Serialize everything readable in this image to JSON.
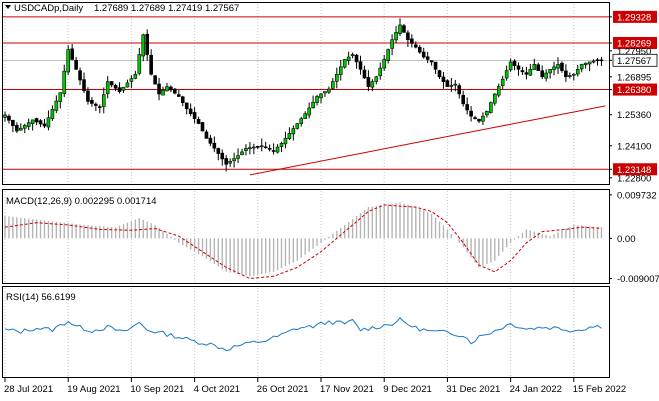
{
  "window": {
    "symbol_timeframe": "USDCADp,Daily",
    "ohlc": "1.27689 1.27689 1.27419 1.27567",
    "icon": "chart-arrow-icon"
  },
  "colors": {
    "background": "#ffffff",
    "grid": "#c8c8c8",
    "border": "#000000",
    "candle_up": "#000000",
    "candle_up_body": "#00c800",
    "candle_down": "#000000",
    "resistance_line": "#cc0000",
    "label_bg": "#cc0000",
    "label_text": "#ffffff",
    "price_label_bg": "#ffffff",
    "macd_hist": "#b4b4b4",
    "macd_signal": "#cc0000",
    "rsi_line": "#1e78c8"
  },
  "chart_data": [
    {
      "type": "candlestick",
      "panel": "price",
      "title": "USDCADp,Daily",
      "ylim": [
        1.2255,
        1.2985
      ],
      "y_ticks": [
        "1.29328",
        "1.28269",
        "1.27950",
        "1.27567",
        "1.26895",
        "1.26380",
        "1.25360",
        "1.24100",
        "1.23148",
        "1.22800"
      ],
      "x_tick_labels": [
        "28 Jul 2021",
        "19 Aug 2021",
        "10 Sep 2021",
        "4 Oct 2021",
        "26 Oct 2021",
        "17 Nov 2021",
        "9 Dec 2021",
        "31 Dec 2021",
        "24 Jan 2022",
        "15 Feb 2022"
      ],
      "x_tick_index": [
        0,
        16,
        32,
        48,
        64,
        80,
        96,
        112,
        128,
        144
      ],
      "close_anchors": [
        [
          0,
          1.2535
        ],
        [
          3,
          1.247
        ],
        [
          7,
          1.2515
        ],
        [
          10,
          1.249
        ],
        [
          14,
          1.2625
        ],
        [
          16,
          1.28
        ],
        [
          18,
          1.272
        ],
        [
          21,
          1.259
        ],
        [
          24,
          1.2565
        ],
        [
          26,
          1.267
        ],
        [
          29,
          1.263
        ],
        [
          33,
          1.27
        ],
        [
          35,
          1.286
        ],
        [
          37,
          1.27
        ],
        [
          39,
          1.262
        ],
        [
          41,
          1.265
        ],
        [
          44,
          1.261
        ],
        [
          46,
          1.256
        ],
        [
          49,
          1.25
        ],
        [
          51,
          1.244
        ],
        [
          53,
          1.24
        ],
        [
          56,
          1.2335
        ],
        [
          59,
          1.237
        ],
        [
          61,
          1.24
        ],
        [
          65,
          1.241
        ],
        [
          68,
          1.239
        ],
        [
          70,
          1.242
        ],
        [
          73,
          1.248
        ],
        [
          76,
          1.254
        ],
        [
          79,
          1.261
        ],
        [
          82,
          1.264
        ],
        [
          84,
          1.27
        ],
        [
          86,
          1.276
        ],
        [
          88,
          1.278
        ],
        [
          90,
          1.272
        ],
        [
          92,
          1.265
        ],
        [
          94,
          1.269
        ],
        [
          96,
          1.276
        ],
        [
          98,
          1.284
        ],
        [
          100,
          1.29
        ],
        [
          102,
          1.284
        ],
        [
          104,
          1.281
        ],
        [
          106,
          1.277
        ],
        [
          108,
          1.275
        ],
        [
          110,
          1.269
        ],
        [
          112,
          1.265
        ],
        [
          114,
          1.266
        ],
        [
          116,
          1.258
        ],
        [
          118,
          1.253
        ],
        [
          120,
          1.251
        ],
        [
          122,
          1.255
        ],
        [
          124,
          1.262
        ],
        [
          126,
          1.268
        ],
        [
          128,
          1.275
        ],
        [
          130,
          1.272
        ],
        [
          132,
          1.27
        ],
        [
          134,
          1.274
        ],
        [
          136,
          1.269
        ],
        [
          138,
          1.272
        ],
        [
          140,
          1.274
        ],
        [
          142,
          1.269
        ],
        [
          144,
          1.27
        ],
        [
          146,
          1.274
        ],
        [
          148,
          1.275
        ],
        [
          150,
          1.2757
        ]
      ],
      "levels": [
        {
          "value": 1.29328,
          "label": "1.29328"
        },
        {
          "value": 1.28269,
          "label": "1.28269"
        },
        {
          "value": 1.2638,
          "label": "1.26380"
        },
        {
          "value": 1.23148,
          "label": "1.23148"
        }
      ],
      "trendline": {
        "from": [
          62,
          1.2292
        ],
        "to": [
          151,
          1.2572
        ]
      },
      "current_price": {
        "value": 1.27567,
        "label": "1.27567"
      }
    },
    {
      "type": "line",
      "panel": "macd",
      "title": "MACD(12,26,9) 0.002295 0.001714",
      "ylim": [
        -0.01,
        0.0106
      ],
      "y_ticks": [
        "0.009732",
        "0.00",
        "-0.009007"
      ],
      "histogram_anchors": [
        [
          0,
          0.005
        ],
        [
          10,
          0.004
        ],
        [
          20,
          0.003
        ],
        [
          28,
          0.0025
        ],
        [
          34,
          0.0045
        ],
        [
          38,
          0.003
        ],
        [
          44,
          -0.001
        ],
        [
          50,
          -0.004
        ],
        [
          56,
          -0.0075
        ],
        [
          62,
          -0.0085
        ],
        [
          68,
          -0.0075
        ],
        [
          74,
          -0.005
        ],
        [
          80,
          -0.001
        ],
        [
          86,
          0.003
        ],
        [
          92,
          0.007
        ],
        [
          96,
          0.0075
        ],
        [
          100,
          0.008
        ],
        [
          104,
          0.007
        ],
        [
          108,
          0.0055
        ],
        [
          112,
          0.002
        ],
        [
          116,
          -0.002
        ],
        [
          120,
          -0.0065
        ],
        [
          124,
          -0.005
        ],
        [
          128,
          -0.001
        ],
        [
          132,
          0.002
        ],
        [
          138,
          0.0005
        ],
        [
          144,
          0.003
        ],
        [
          150,
          0.0025
        ]
      ],
      "signal_anchors": [
        [
          0,
          0.0025
        ],
        [
          8,
          0.0035
        ],
        [
          16,
          0.003
        ],
        [
          24,
          0.002
        ],
        [
          32,
          0.0018
        ],
        [
          38,
          0.0022
        ],
        [
          44,
          0.0005
        ],
        [
          50,
          -0.003
        ],
        [
          56,
          -0.0065
        ],
        [
          62,
          -0.009
        ],
        [
          68,
          -0.0085
        ],
        [
          74,
          -0.0065
        ],
        [
          80,
          -0.003
        ],
        [
          86,
          0.0015
        ],
        [
          92,
          0.006
        ],
        [
          96,
          0.0075
        ],
        [
          100,
          0.0072
        ],
        [
          104,
          0.007
        ],
        [
          108,
          0.006
        ],
        [
          112,
          0.0035
        ],
        [
          116,
          -0.001
        ],
        [
          120,
          -0.006
        ],
        [
          124,
          -0.0075
        ],
        [
          128,
          -0.005
        ],
        [
          132,
          -0.001
        ],
        [
          136,
          0.0015
        ],
        [
          142,
          0.002
        ],
        [
          146,
          0.0025
        ],
        [
          150,
          0.0023
        ]
      ],
      "series": [
        {
          "name": "MACD",
          "style": "histogram"
        },
        {
          "name": "Signal",
          "style": "dashed-line"
        }
      ]
    },
    {
      "type": "line",
      "panel": "rsi",
      "title": "RSI(14) 56.6199",
      "ylim": [
        0,
        100
      ],
      "series_anchors": [
        [
          0,
          53
        ],
        [
          4,
          51
        ],
        [
          8,
          55
        ],
        [
          12,
          53
        ],
        [
          16,
          63
        ],
        [
          18,
          57
        ],
        [
          22,
          52
        ],
        [
          26,
          56
        ],
        [
          30,
          50
        ],
        [
          34,
          61
        ],
        [
          36,
          53
        ],
        [
          40,
          49
        ],
        [
          44,
          45
        ],
        [
          48,
          40
        ],
        [
          52,
          37
        ],
        [
          56,
          31
        ],
        [
          58,
          34
        ],
        [
          62,
          38
        ],
        [
          66,
          41
        ],
        [
          70,
          47
        ],
        [
          74,
          55
        ],
        [
          78,
          57
        ],
        [
          82,
          62
        ],
        [
          86,
          60
        ],
        [
          88,
          63
        ],
        [
          90,
          53
        ],
        [
          94,
          56
        ],
        [
          98,
          60
        ],
        [
          100,
          64
        ],
        [
          104,
          55
        ],
        [
          108,
          51
        ],
        [
          112,
          50
        ],
        [
          116,
          47
        ],
        [
          118,
          39
        ],
        [
          120,
          45
        ],
        [
          124,
          52
        ],
        [
          128,
          60
        ],
        [
          132,
          54
        ],
        [
          136,
          56
        ],
        [
          140,
          55
        ],
        [
          144,
          52
        ],
        [
          148,
          56
        ],
        [
          150,
          57
        ]
      ],
      "series": [
        {
          "name": "RSI(14)",
          "style": "line"
        }
      ]
    }
  ]
}
